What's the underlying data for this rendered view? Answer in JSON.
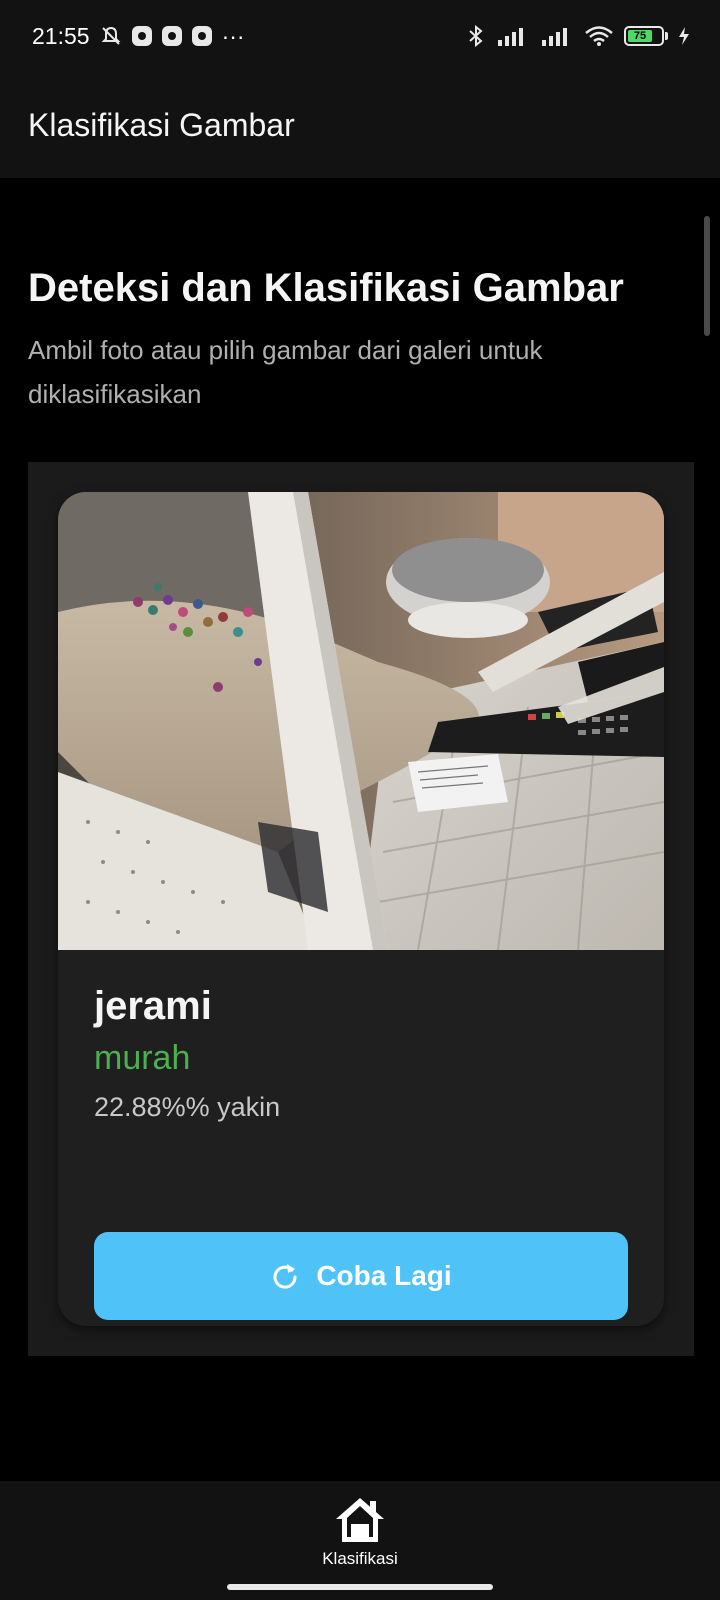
{
  "status_bar": {
    "time": "21:55",
    "more": "···",
    "battery_level": "75",
    "battery_color": "#4cd964"
  },
  "app_bar": {
    "title": "Klasifikasi Gambar"
  },
  "main": {
    "heading": "Deteksi dan Klasifikasi Gambar",
    "subheading": "Ambil foto atau pilih gambar dari galeri untuk diklasifikasikan"
  },
  "result": {
    "label": "jerami",
    "class": "murah",
    "class_color": "#4caf50",
    "confidence": "22.88%% yakin",
    "retry_label": "Coba Lagi",
    "retry_icon": "refresh-icon",
    "button_color": "#4fc3f7"
  },
  "bottom_nav": {
    "items": [
      {
        "label": "Klasifikasi",
        "icon": "home-icon",
        "active": true
      }
    ]
  }
}
